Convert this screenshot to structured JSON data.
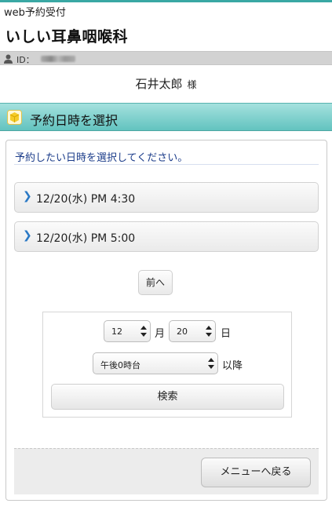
{
  "header": {
    "service_label": "web予約受付",
    "clinic_name": "いしい耳鼻咽喉科",
    "id_label": "ID："
  },
  "user": {
    "name": "石井太郎",
    "honorific": "様"
  },
  "section": {
    "title": "予約日時を選択"
  },
  "instruction": "予約したい日時を選択してください。",
  "time_slots": [
    {
      "label": "12/20(水) PM 4:30"
    },
    {
      "label": "12/20(水) PM 5:00"
    }
  ],
  "prev_button": "前へ",
  "search": {
    "month_value": "12",
    "month_unit": "月",
    "day_value": "20",
    "day_unit": "日",
    "time_value": "午後0時台",
    "time_unit": "以降",
    "search_button": "検索"
  },
  "back_button": "メニューへ戻る",
  "colors": {
    "accent_teal": "#62c3bf",
    "instruction_blue": "#1b3c8a",
    "chevron_blue": "#2a79c5"
  }
}
